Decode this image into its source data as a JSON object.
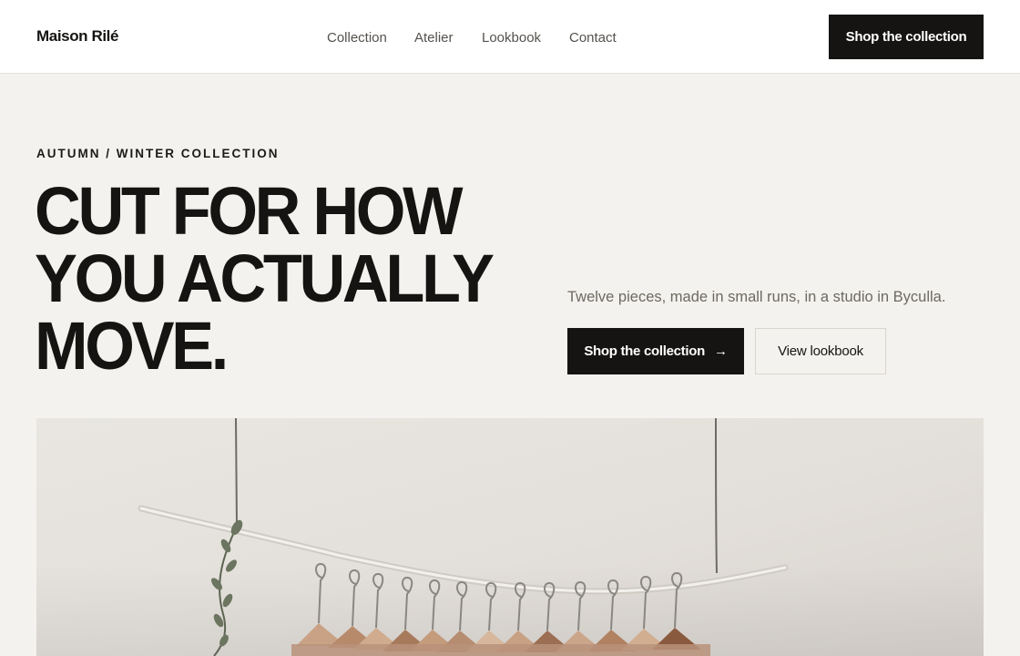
{
  "header": {
    "brand": "Maison Rilé",
    "nav": [
      "Collection",
      "Atelier",
      "Lookbook",
      "Contact"
    ],
    "cta": "Shop the collection"
  },
  "hero": {
    "eyebrow": "AUTUMN / WINTER COLLECTION",
    "headline": [
      "CUT FOR HOW",
      "YOU ACTUALLY",
      "MOVE."
    ],
    "tagline": "Twelve pieces, made in small runs, in a studio in Byculla.",
    "primary_cta": "Shop the collection",
    "primary_cta_icon": "arrow-right-icon",
    "secondary_cta": "View lookbook",
    "image": "clothing-rack-photo"
  },
  "colors": {
    "background": "#f4f2ee",
    "header": "#ffffff",
    "ink": "#151412",
    "muted": "#6d6962"
  }
}
